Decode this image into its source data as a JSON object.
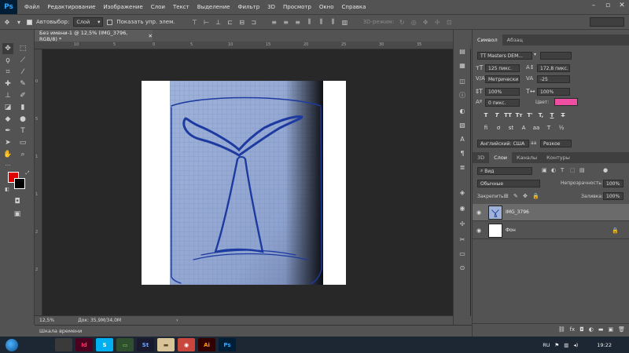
{
  "app": {
    "logo": "Ps"
  },
  "menu": [
    "Файл",
    "Редактирование",
    "Изображение",
    "Слои",
    "Текст",
    "Выделение",
    "Фильтр",
    "3D",
    "Просмотр",
    "Окно",
    "Справка"
  ],
  "options": {
    "autoselect_label": "Автовыбор:",
    "autoselect_value": "Слой",
    "show_controls_label": "Показать упр. элем.",
    "mode3d_label": "3D-режим:"
  },
  "document": {
    "tab_title": "Без имени-1 @ 12,5% (IMG_3796, RGB/8) *",
    "zoom": "12,5%",
    "doc_size": "Док: 35,9M/34,0M"
  },
  "ruler": {
    "h_labels": [
      "10",
      "5",
      "0",
      "5",
      "10",
      "15",
      "20",
      "25",
      "30",
      "35",
      "40"
    ],
    "v_labels": [
      "0",
      "5",
      "1",
      "1",
      "2",
      "2"
    ]
  },
  "timeline": {
    "label": "Шкала времени"
  },
  "character_panel": {
    "tabs": [
      "Символ",
      "Абзац"
    ],
    "font_family": "TT Masters DEM...",
    "font_size": "125 пикс.",
    "leading": "172,8 пикс.",
    "kerning": "Метрически",
    "tracking": "-25",
    "vscale": "100%",
    "hscale": "100%",
    "baseline": "0 пикс.",
    "color_label": "Цвет:",
    "color_value": "#ef4fa1",
    "type_buttons": [
      "T",
      "T",
      "TT",
      "Tт",
      "T'",
      "T,",
      "T",
      "T"
    ],
    "language": "Английский: США",
    "antialias": "Резкое",
    "aa_prefix": "aa"
  },
  "layers_panel": {
    "tabs": [
      "3D",
      "Слои",
      "Каналы",
      "Контуры"
    ],
    "filter_label": "Вид",
    "blend_mode": "Обычные",
    "opacity_label": "Непрозрачность:",
    "opacity_value": "100%",
    "lock_label": "Закрепить:",
    "fill_label": "Заливка:",
    "fill_value": "100%",
    "layers": [
      {
        "name": "IMG_3796",
        "selected": true
      },
      {
        "name": "Фон",
        "selected": false,
        "locked": true
      }
    ]
  },
  "taskbar": {
    "lang": "RU",
    "time": "19:22",
    "apps": [
      {
        "label": "",
        "color": "#3a3a3a",
        "fg": "#fff"
      },
      {
        "label": "Id",
        "color": "#49021f",
        "fg": "#ff3366"
      },
      {
        "label": "S",
        "color": "#00aff0",
        "fg": "#fff"
      },
      {
        "label": "▭",
        "color": "#2f4f2f",
        "fg": "#7fdc4f"
      },
      {
        "label": "St",
        "color": "#1a1a2e",
        "fg": "#6fa8ff"
      },
      {
        "label": "▬",
        "color": "#d9c49a",
        "fg": "#5a4a2a"
      },
      {
        "label": "◉",
        "color": "#c9463d",
        "fg": "#fff"
      },
      {
        "label": "Ai",
        "color": "#330000",
        "fg": "#ff9a00"
      },
      {
        "label": "Ps",
        "color": "#001e36",
        "fg": "#31a8ff"
      }
    ]
  },
  "colors": {
    "foreground": "#e00000",
    "background": "#000000"
  }
}
